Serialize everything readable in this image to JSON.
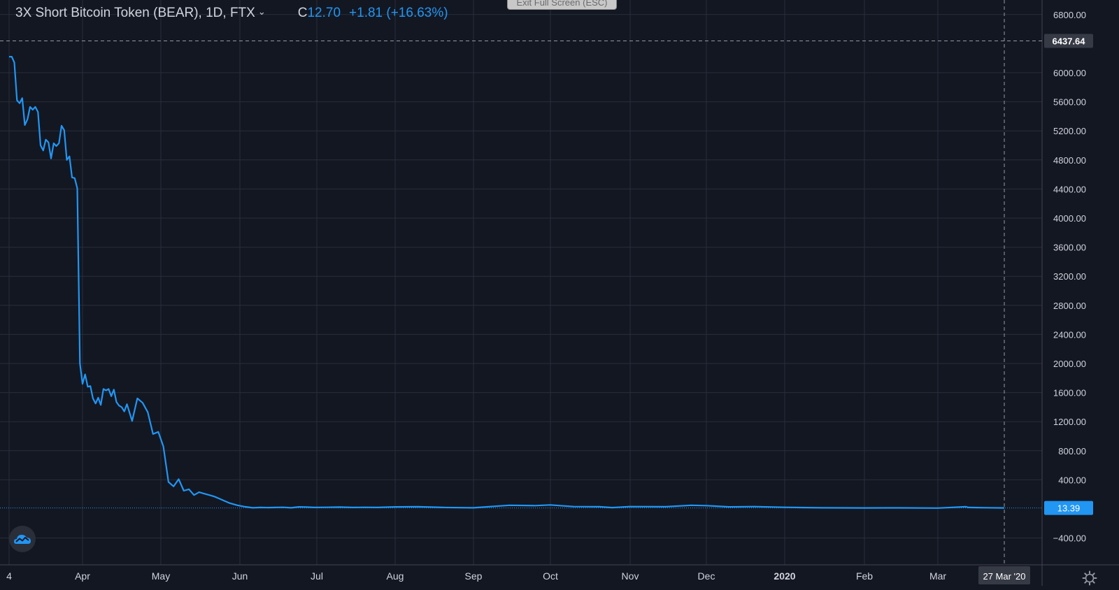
{
  "legend": {
    "title": "3X Short Bitcoin Token (BEAR), 1D, FTX",
    "chevron_icon": "chevron-down-icon",
    "close_label": "C",
    "close_value": "12.70",
    "change": "+1.81 (+16.63%)"
  },
  "fullscreen_banner": {
    "label": "Exit Full Screen (ESC)"
  },
  "icons": {
    "brand": "tradingview-cloud-icon",
    "settings": "gear-icon"
  },
  "colors": {
    "background": "#131722",
    "grid": "#2a2e39",
    "series_line": "#2196f3",
    "text": "#d1d4dc",
    "crosshair_label_bg": "#363a45",
    "last_price_label_bg": "#2196f3"
  },
  "chart_data": {
    "type": "line",
    "title": "3X Short Bitcoin Token (BEAR), 1D, FTX",
    "xlabel": "",
    "ylabel": "",
    "ylim": [
      -520,
      6950
    ],
    "xlim": [
      "2019-03-05",
      "2020-04-15"
    ],
    "grid": true,
    "x_ticks": [
      {
        "label": "4",
        "date": "2019-03-04"
      },
      {
        "label": "Apr",
        "date": "2019-04-01"
      },
      {
        "label": "May",
        "date": "2019-05-01"
      },
      {
        "label": "Jun",
        "date": "2019-06-01"
      },
      {
        "label": "Jul",
        "date": "2019-07-01"
      },
      {
        "label": "Aug",
        "date": "2019-08-01"
      },
      {
        "label": "Sep",
        "date": "2019-09-01"
      },
      {
        "label": "Oct",
        "date": "2019-10-01"
      },
      {
        "label": "Nov",
        "date": "2019-11-01"
      },
      {
        "label": "Dec",
        "date": "2019-12-01"
      },
      {
        "label": "2020",
        "date": "2020-01-01",
        "bold": true
      },
      {
        "label": "Feb",
        "date": "2020-02-01"
      },
      {
        "label": "Mar",
        "date": "2020-03-01"
      }
    ],
    "y_ticks": [
      -400,
      400,
      800,
      1200,
      1600,
      2000,
      2400,
      2800,
      3200,
      3600,
      4000,
      4400,
      4800,
      5200,
      5600,
      6000,
      6800
    ],
    "y_tick_labels": [
      "−400.00",
      "400.00",
      "800.00",
      "1200.00",
      "1600.00",
      "2000.00",
      "2400.00",
      "2800.00",
      "3200.00",
      "3600.00",
      "4000.00",
      "4400.00",
      "4800.00",
      "5200.00",
      "5600.00",
      "6000.00",
      "6800.00"
    ],
    "crosshair": {
      "date": "2020-03-27",
      "date_label": "27 Mar '20",
      "price": 6437.64,
      "price_label": "6437.64"
    },
    "last_price": {
      "value": 13.39,
      "label": "13.39"
    },
    "series": [
      {
        "x": [
          "2019-03-04",
          "2019-03-05",
          "2019-03-06",
          "2019-03-07",
          "2019-03-08",
          "2019-03-09",
          "2019-03-10",
          "2019-03-11",
          "2019-03-12",
          "2019-03-13",
          "2019-03-14",
          "2019-03-15",
          "2019-03-16",
          "2019-03-17",
          "2019-03-18",
          "2019-03-19",
          "2019-03-20",
          "2019-03-21",
          "2019-03-22",
          "2019-03-23",
          "2019-03-24",
          "2019-03-25",
          "2019-03-26",
          "2019-03-27",
          "2019-03-28",
          "2019-03-29",
          "2019-03-30",
          "2019-03-31",
          "2019-04-01",
          "2019-04-02",
          "2019-04-03",
          "2019-04-04",
          "2019-04-05",
          "2019-04-06",
          "2019-04-07",
          "2019-04-08",
          "2019-04-09",
          "2019-04-10",
          "2019-04-11",
          "2019-04-12",
          "2019-04-13",
          "2019-04-14",
          "2019-04-15",
          "2019-04-16",
          "2019-04-17",
          "2019-04-18",
          "2019-04-20",
          "2019-04-22",
          "2019-04-24",
          "2019-04-26",
          "2019-04-28",
          "2019-04-30",
          "2019-05-02",
          "2019-05-04",
          "2019-05-06",
          "2019-05-08",
          "2019-05-10",
          "2019-05-12",
          "2019-05-14",
          "2019-05-16",
          "2019-05-18",
          "2019-05-20",
          "2019-05-22",
          "2019-05-24",
          "2019-05-26",
          "2019-05-28",
          "2019-05-31",
          "2019-06-03",
          "2019-06-06",
          "2019-06-09",
          "2019-06-12",
          "2019-06-15",
          "2019-06-18",
          "2019-06-21",
          "2019-06-24",
          "2019-06-27",
          "2019-06-30",
          "2019-07-05",
          "2019-07-10",
          "2019-07-15",
          "2019-07-20",
          "2019-07-25",
          "2019-08-01",
          "2019-08-10",
          "2019-08-20",
          "2019-09-01",
          "2019-09-15",
          "2019-09-25",
          "2019-10-01",
          "2019-10-10",
          "2019-10-20",
          "2019-10-25",
          "2019-11-01",
          "2019-11-15",
          "2019-11-25",
          "2019-12-01",
          "2019-12-10",
          "2019-12-20",
          "2020-01-01",
          "2020-01-15",
          "2020-02-01",
          "2020-02-15",
          "2020-03-01",
          "2020-03-12",
          "2020-03-13",
          "2020-03-20",
          "2020-03-27"
        ],
        "y": [
          6220,
          6220,
          6140,
          5620,
          5580,
          5650,
          5280,
          5360,
          5530,
          5490,
          5530,
          5460,
          5000,
          4930,
          5080,
          5040,
          4820,
          5030,
          4990,
          5030,
          5270,
          5210,
          4800,
          4850,
          4560,
          4550,
          4410,
          2000,
          1720,
          1850,
          1680,
          1690,
          1520,
          1450,
          1530,
          1430,
          1650,
          1630,
          1650,
          1550,
          1640,
          1470,
          1420,
          1400,
          1340,
          1440,
          1210,
          1520,
          1460,
          1330,
          1030,
          1060,
          860,
          370,
          310,
          410,
          250,
          270,
          190,
          230,
          210,
          190,
          170,
          140,
          110,
          80,
          50,
          30,
          15,
          20,
          18,
          20,
          22,
          15,
          28,
          25,
          20,
          22,
          25,
          20,
          22,
          20,
          28,
          30,
          20,
          15,
          50,
          45,
          55,
          32,
          30,
          18,
          32,
          30,
          50,
          45,
          28,
          32,
          22,
          15,
          13,
          14,
          12,
          30,
          20,
          16,
          13.39
        ]
      }
    ]
  }
}
